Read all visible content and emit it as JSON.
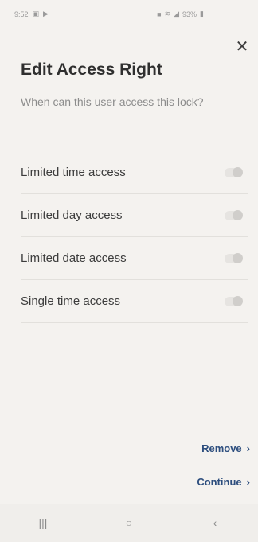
{
  "status_bar": {
    "time": "9:52",
    "battery": "93%"
  },
  "dialog": {
    "title": "Edit Access Right",
    "subtitle": "When can this user access this lock?",
    "close_icon": "close-icon"
  },
  "options": [
    {
      "label": "Limited time access",
      "enabled": false
    },
    {
      "label": "Limited day access",
      "enabled": false
    },
    {
      "label": "Limited date access",
      "enabled": false
    },
    {
      "label": "Single time access",
      "enabled": false
    }
  ],
  "actions": {
    "remove": "Remove",
    "continue": "Continue",
    "chevron": "›"
  },
  "nav": {
    "recents": "|||",
    "home": "○",
    "back": "‹"
  }
}
